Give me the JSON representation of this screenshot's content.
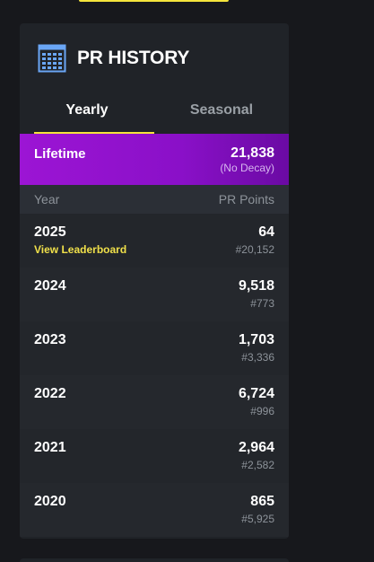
{
  "card": {
    "title": "PR HISTORY",
    "icon": "calendar-icon"
  },
  "tabs": [
    {
      "label": "Yearly",
      "active": true
    },
    {
      "label": "Seasonal",
      "active": false
    }
  ],
  "lifetime": {
    "label": "Lifetime",
    "value": "21,838",
    "note": "(No Decay)"
  },
  "table": {
    "col_year": "Year",
    "col_points": "PR Points",
    "rows": [
      {
        "year": "2025",
        "link": "View Leaderboard",
        "points": "64",
        "rank": "#20,152"
      },
      {
        "year": "2024",
        "link": "",
        "points": "9,518",
        "rank": "#773"
      },
      {
        "year": "2023",
        "link": "",
        "points": "1,703",
        "rank": "#3,336"
      },
      {
        "year": "2022",
        "link": "",
        "points": "6,724",
        "rank": "#996"
      },
      {
        "year": "2021",
        "link": "",
        "points": "2,964",
        "rank": "#2,582"
      },
      {
        "year": "2020",
        "link": "",
        "points": "865",
        "rank": "#5,925"
      }
    ]
  },
  "colors": {
    "accent_yellow": "#f5e43c",
    "lifetime_purple": "#9c15d4",
    "card_bg": "#202328",
    "page_bg": "#17181c"
  }
}
